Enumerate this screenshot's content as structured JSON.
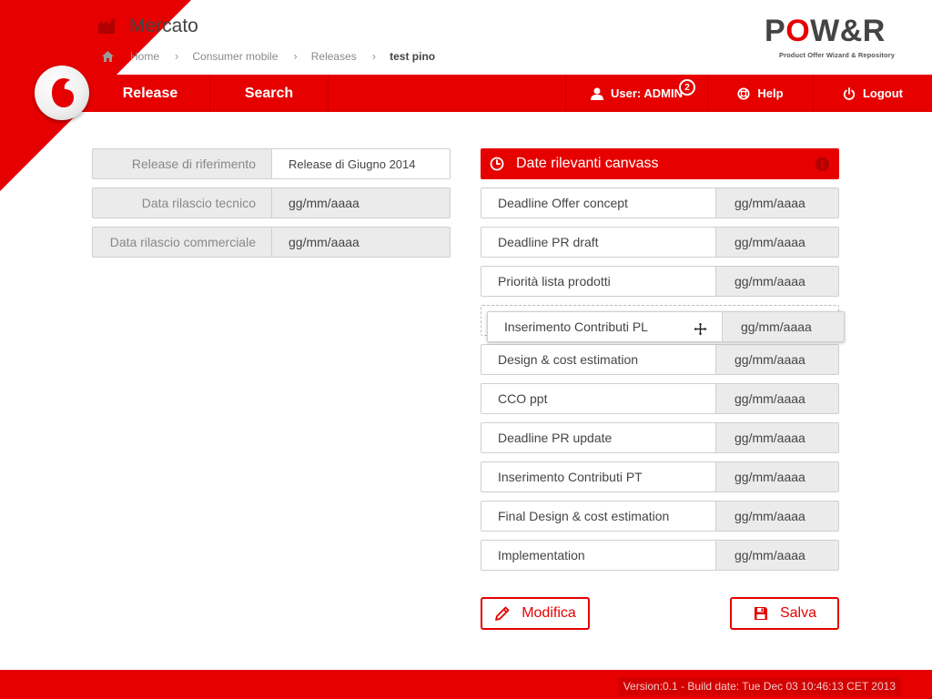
{
  "header": {
    "section_title": "Mercato",
    "breadcrumb": [
      "Home",
      "Consumer mobile",
      "Releases",
      "test pino"
    ]
  },
  "brand": {
    "name_prefix": "P",
    "name_o": "O",
    "name_suffix": "W&R",
    "tagline": "Product Offer Wizard & Repository"
  },
  "nav": {
    "release": "Release",
    "search": "Search",
    "user": "User: ADMIN",
    "user_badge": "2",
    "help": "Help",
    "logout": "Logout"
  },
  "left_form": [
    {
      "label": "Release di riferimento",
      "value": "Release di Giugno 2014"
    },
    {
      "label": "Data rilascio tecnico",
      "value": "gg/mm/aaaa"
    },
    {
      "label": "Data rilascio commerciale",
      "value": "gg/mm/aaaa"
    }
  ],
  "panel": {
    "title": "Date rilevanti canvass",
    "rows": [
      {
        "label": "Deadline Offer concept",
        "value": "gg/mm/aaaa"
      },
      {
        "label": "Deadline PR draft",
        "value": "gg/mm/aaaa"
      },
      {
        "label": "Priorità lista prodotti",
        "value": "gg/mm/aaaa"
      },
      {
        "label": "Inserimento Contributi PL",
        "value": "gg/mm/aaaa"
      },
      {
        "label": "Design & cost estimation",
        "value": "gg/mm/aaaa"
      },
      {
        "label": "CCO ppt",
        "value": "gg/mm/aaaa"
      },
      {
        "label": "Deadline PR update",
        "value": "gg/mm/aaaa"
      },
      {
        "label": "Inserimento Contributi PT",
        "value": "gg/mm/aaaa"
      },
      {
        "label": "Final Design & cost estimation",
        "value": "gg/mm/aaaa"
      },
      {
        "label": "Implementation",
        "value": "gg/mm/aaaa"
      }
    ]
  },
  "buttons": {
    "modifica": "Modifica",
    "salva": "Salva"
  },
  "footer": {
    "version": "Version:0.1 - Build date: Tue Dec 03 10:46:13 CET 2013"
  },
  "colors": {
    "brand_red": "#e60000",
    "field_gray": "#ebebeb",
    "border_gray": "#cfcfcf"
  }
}
